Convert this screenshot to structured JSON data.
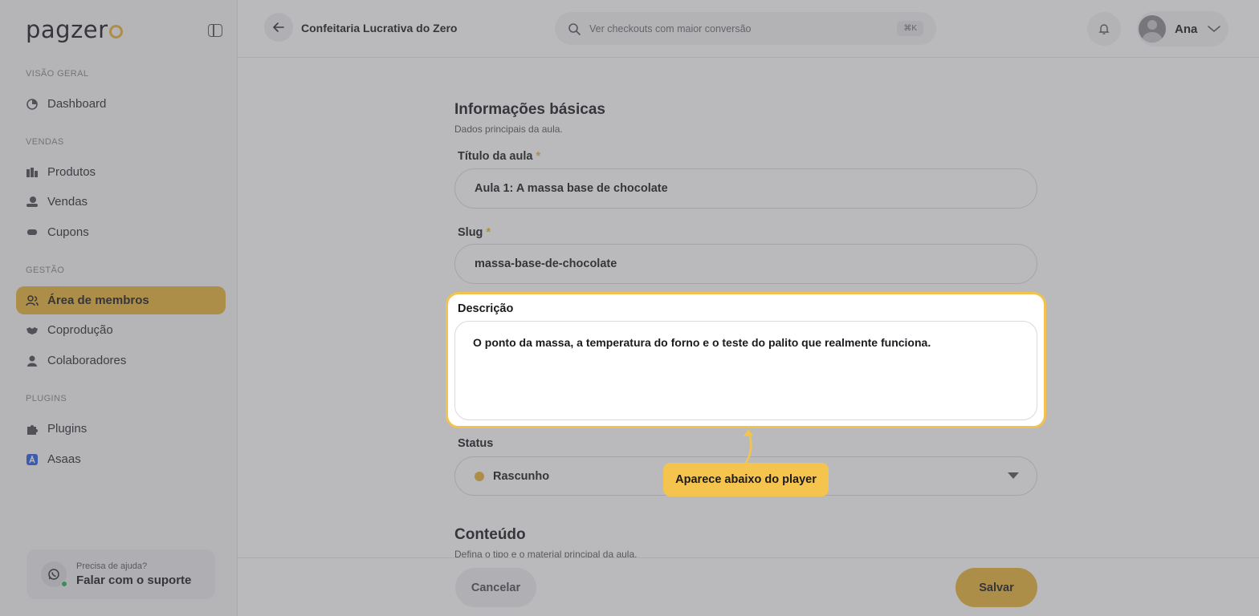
{
  "sidebar": {
    "logo_text": "pagzer",
    "sections": {
      "overview": "VISÃO GERAL",
      "sales": "VENDAS",
      "management": "GESTÃO",
      "plugins": "PLUGINS"
    },
    "items": [
      {
        "label": "Dashboard",
        "icon": "dashboard-icon"
      },
      {
        "label": "Produtos",
        "icon": "products-icon"
      },
      {
        "label": "Vendas",
        "icon": "sales-icon"
      },
      {
        "label": "Cupons",
        "icon": "coupon-icon"
      },
      {
        "label": "Área de membros",
        "icon": "members-icon",
        "active": true
      },
      {
        "label": "Coprodução",
        "icon": "handshake-icon"
      },
      {
        "label": "Colaboradores",
        "icon": "user-icon"
      },
      {
        "label": "Plugins",
        "icon": "puzzle-icon"
      },
      {
        "label": "Asaas",
        "icon": "asaas-icon"
      }
    ],
    "help": {
      "small": "Precisa de ajuda?",
      "big": "Falar com o suporte"
    }
  },
  "topbar": {
    "title": "Confeitaria Lucrativa do Zero",
    "search_placeholder": "Ver checkouts com maior conversão",
    "search_shortcut": "⌘K",
    "user_name": "Ana"
  },
  "form": {
    "basic_title": "Informações básicas",
    "basic_subtitle": "Dados principais da aula.",
    "title_label": "Título da aula",
    "title_value": "Aula 1: A massa base de chocolate",
    "slug_label": "Slug",
    "slug_value": "massa-base-de-chocolate",
    "required_mark": "*",
    "description_label": "Descrição",
    "description_value": "O ponto da massa, a temperatura do forno e o teste do palito que realmente funciona.",
    "status_label": "Status",
    "status_value": "Rascunho",
    "content_title": "Conteúdo",
    "content_subtitle": "Defina o tipo e o material principal da aula."
  },
  "tooltip": "Aparece abaixo do player",
  "footer": {
    "cancel": "Cancelar",
    "save": "Salvar"
  },
  "colors": {
    "accent": "#e8b33a",
    "highlight_border": "#f2c14e",
    "tooltip_bg": "#f5c44f"
  }
}
